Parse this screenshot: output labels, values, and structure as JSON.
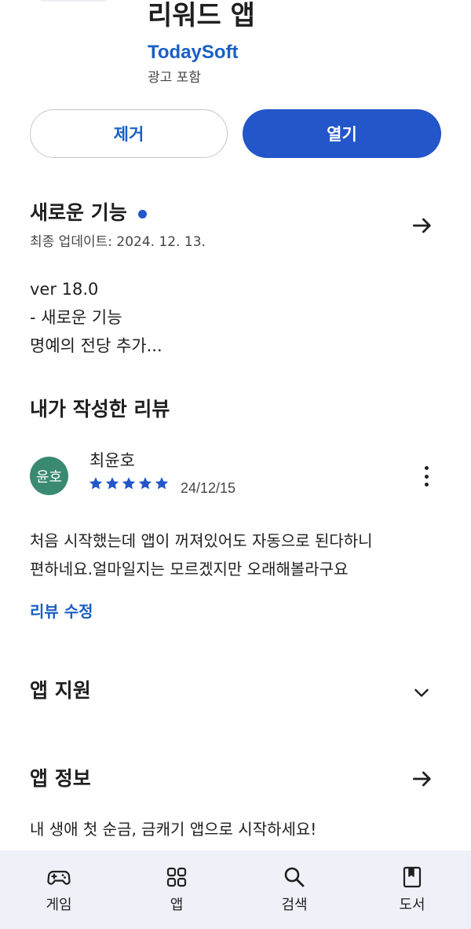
{
  "app": {
    "title": "리워드 앱",
    "developer": "TodaySoft",
    "ads_note": "광고 포함"
  },
  "actions": {
    "remove_label": "제거",
    "open_label": "열기"
  },
  "whats_new": {
    "title": "새로운 기능",
    "last_updated": "최종 업데이트: 2024. 12. 13.",
    "notes": [
      "ver 18.0",
      "- 새로운 기능",
      "명예의 전당 추가..."
    ]
  },
  "my_review": {
    "title": "내가 작성한 리뷰",
    "avatar_text": "윤호",
    "avatar_color": "#3a8a73",
    "reviewer": "최윤호",
    "rating": 5,
    "date": "24/12/15",
    "text_lines": [
      "처음 시작했는데 앱이 꺼져있어도 자동으로 된다하니",
      "편하네요.얼마일지는 모르겠지만 오래해볼라구요"
    ],
    "edit_label": "리뷰 수정"
  },
  "app_support": {
    "title": "앱 지원"
  },
  "app_info": {
    "title": "앱 정보",
    "description": "내 생애 첫 순금, 금캐기 앱으로 시작하세요!"
  },
  "bottom_nav": {
    "items": [
      {
        "label": "게임",
        "icon": "gamepad-icon"
      },
      {
        "label": "앱",
        "icon": "apps-grid-icon"
      },
      {
        "label": "검색",
        "icon": "search-icon"
      },
      {
        "label": "도서",
        "icon": "book-icon"
      }
    ]
  },
  "colors": {
    "accent": "#2356c9",
    "link": "#1a5fc4",
    "nav_background": "#eef2f8"
  }
}
